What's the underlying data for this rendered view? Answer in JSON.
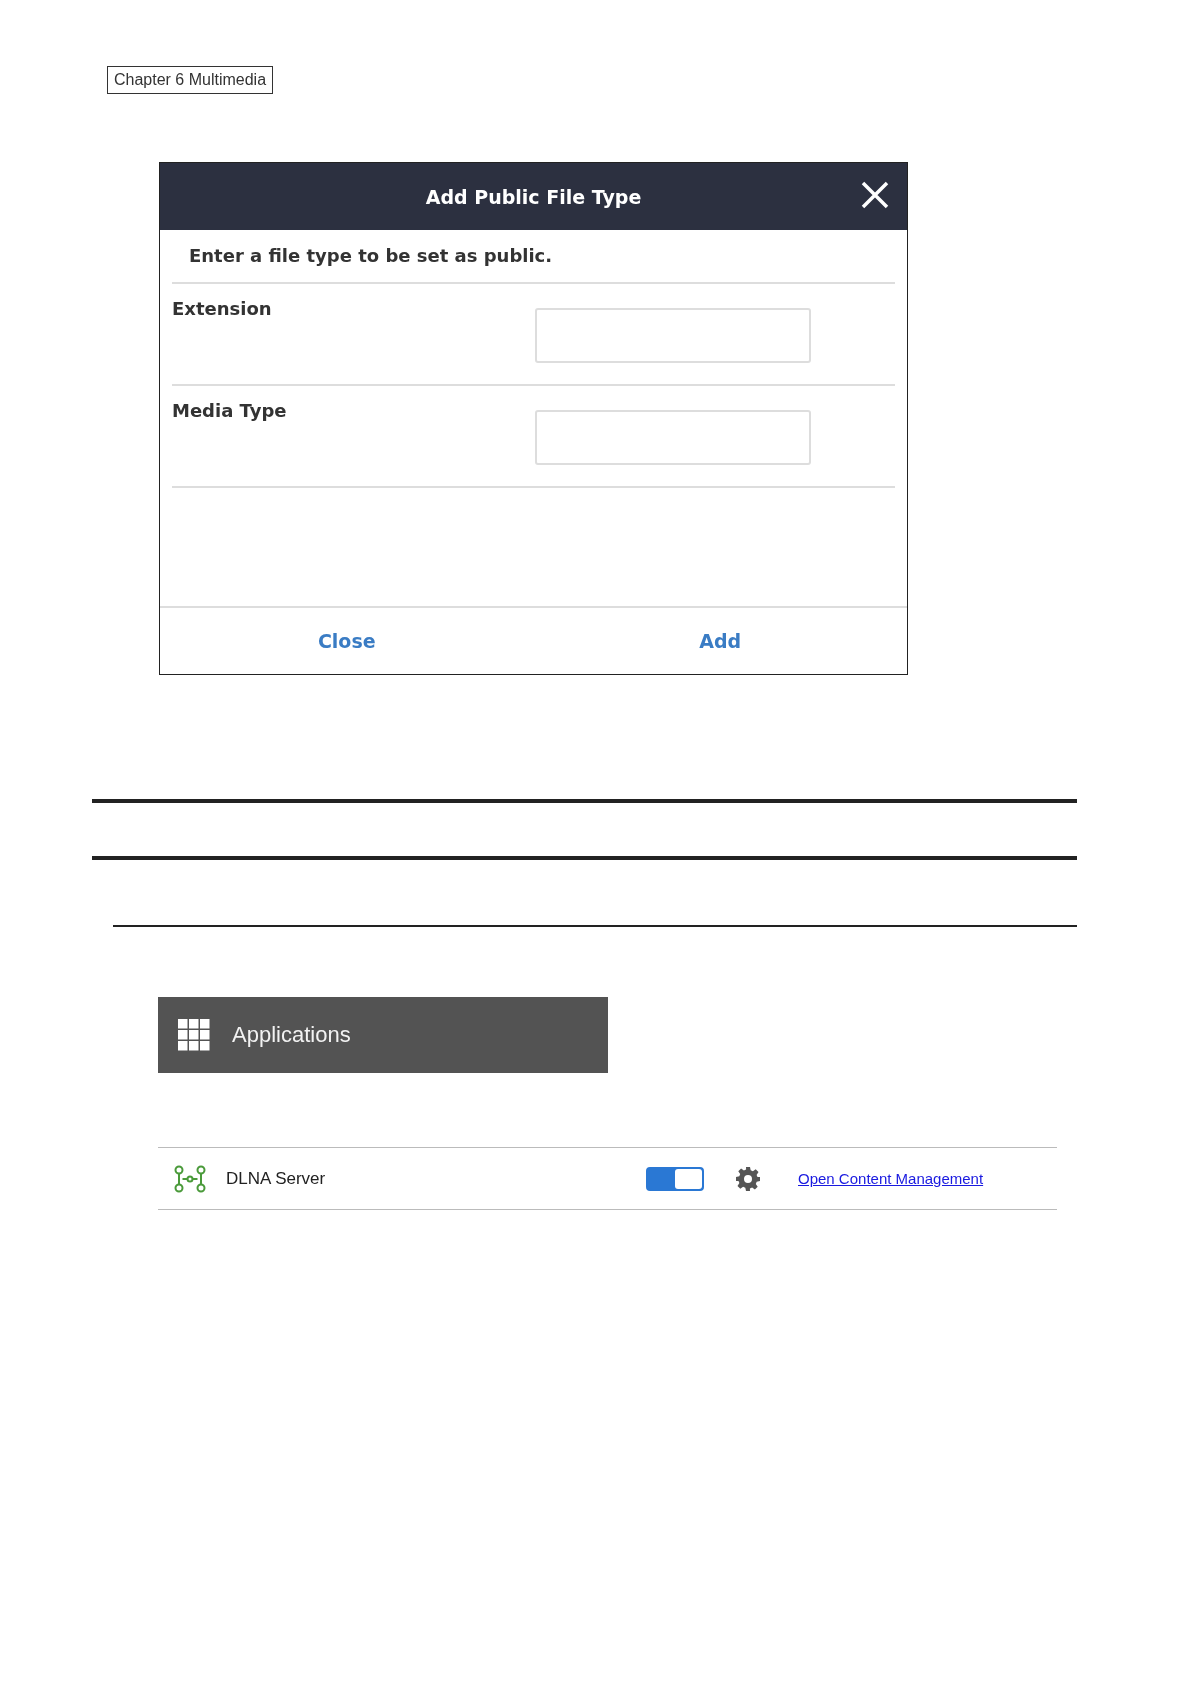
{
  "chapter_label": "Chapter 6 Multimedia",
  "dialog": {
    "title": "Add Public File Type",
    "instruction": "Enter a file type to be set as public.",
    "fields": [
      {
        "label": "Extension"
      },
      {
        "label": "Media Type"
      }
    ],
    "buttons": [
      "Close",
      "Add"
    ]
  },
  "applications_header": {
    "title": "Applications"
  },
  "app_rows": [
    {
      "name": "DLNA Server",
      "on": true,
      "link": "Open Content Management"
    }
  ]
}
